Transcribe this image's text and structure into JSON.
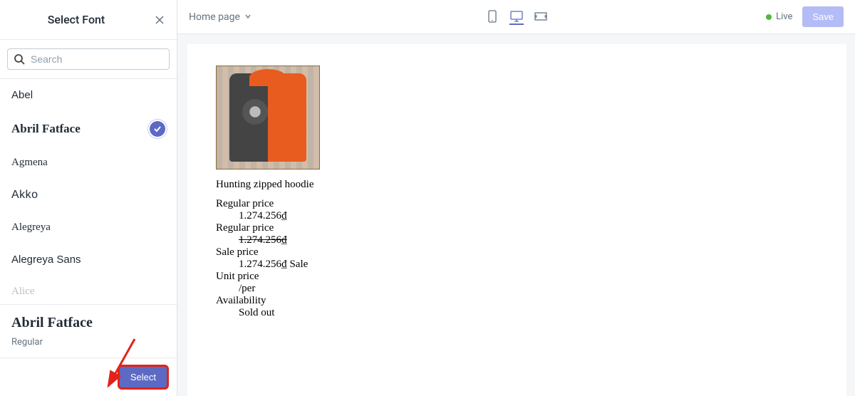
{
  "sidebar": {
    "title": "Select Font",
    "search_placeholder": "Search",
    "fonts": [
      {
        "name": "Abel"
      },
      {
        "name": "Abril Fatface",
        "selected": true
      },
      {
        "name": "Agmena"
      },
      {
        "name": "Akko"
      },
      {
        "name": "Alegreya"
      },
      {
        "name": "Alegreya Sans"
      },
      {
        "name": "Alice"
      }
    ],
    "selected_font": "Abril Fatface",
    "selected_weight": "Regular",
    "select_button": "Select"
  },
  "topbar": {
    "page_label": "Home page",
    "live_label": "Live",
    "save_label": "Save"
  },
  "preview": {
    "product_title": "Hunting zipped hoodie",
    "regular_price_label": "Regular price",
    "regular_price_value": "1.274.256₫",
    "regular_price_label2": "Regular price",
    "regular_price_value2": "1.274.256₫",
    "sale_price_label": "Sale price",
    "sale_price_value": "1.274.256₫ Sale",
    "unit_price_label": "Unit price",
    "unit_price_value": "/per",
    "availability_label": "Availability",
    "availability_value": "Sold out"
  }
}
